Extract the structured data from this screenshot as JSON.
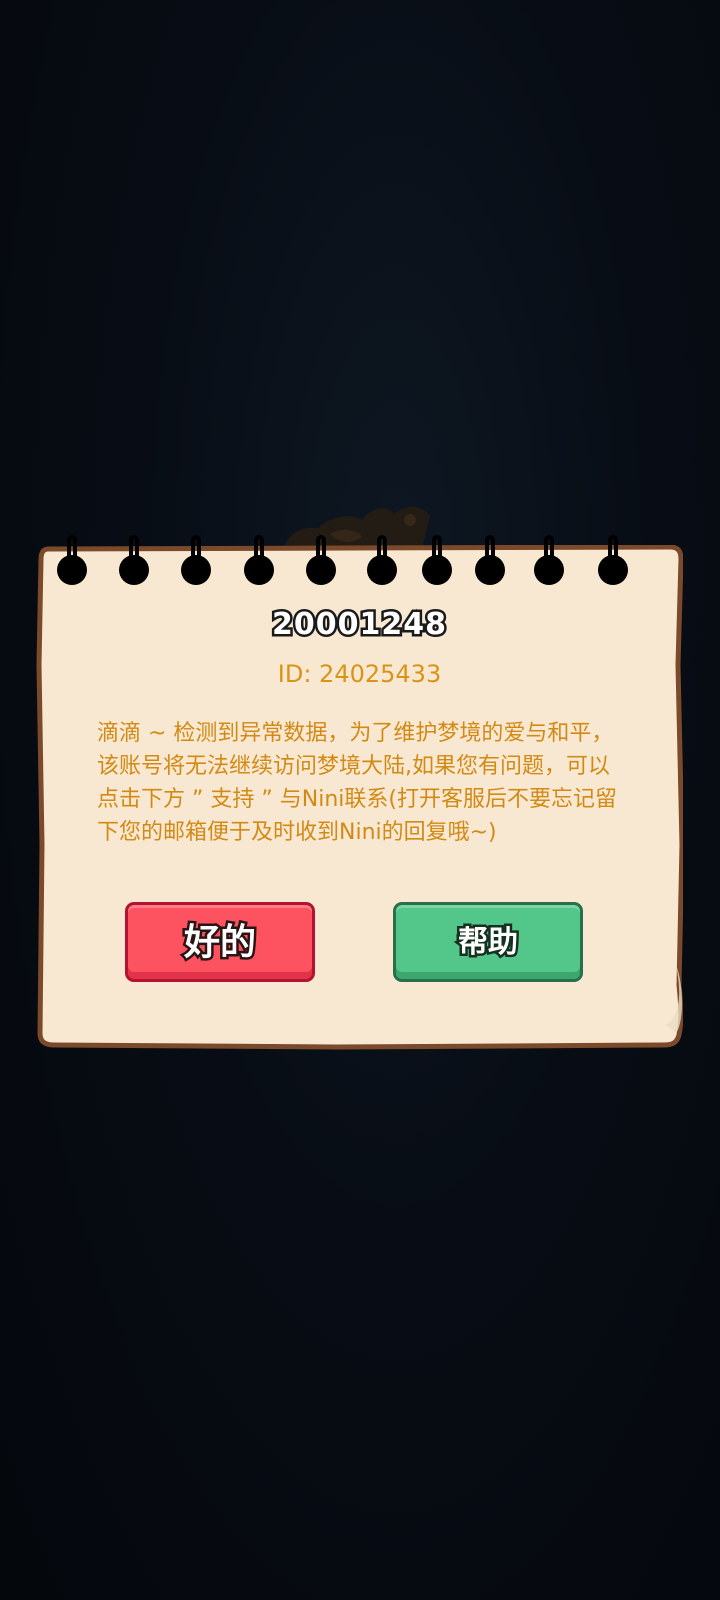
{
  "dialog": {
    "player_name": "20001248",
    "player_id": "ID: 24025433",
    "message": "滴滴 ~ 检测到异常数据，为了维护梦境的爱与和平，该账号将无法继续访问梦境大陆,如果您有问题，可以点击下方 ” 支持 ” 与Nini联系(打开客服后不要忘记留下您的邮箱便于及时收到Nini的回复哦~)",
    "ok_button_label": "好的",
    "help_button_label": "帮助"
  },
  "colors": {
    "backdrop": "#060b12",
    "paper": "#f8e8d2",
    "paper_outline": "#7a4a2a",
    "text_accent": "#d28a14",
    "ok_button": "#fd5360",
    "help_button": "#53c689"
  }
}
